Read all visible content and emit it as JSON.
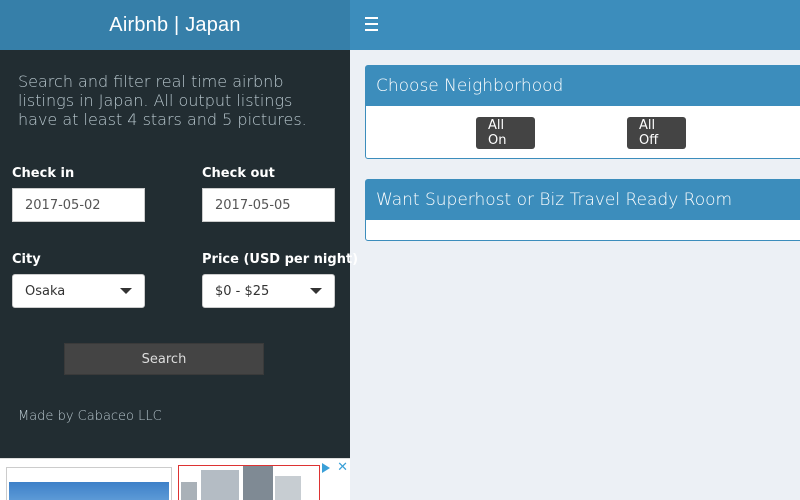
{
  "app": {
    "title": "Airbnb | Japan"
  },
  "sidebar": {
    "intro": "Search and filter real time airbnb listings in Japan. All output listings have at least 4 stars and 5 pictures.",
    "checkin": {
      "label": "Check in",
      "value": "2017-05-02"
    },
    "checkout": {
      "label": "Check out",
      "value": "2017-05-05"
    },
    "city": {
      "label": "City",
      "value": "Osaka"
    },
    "price": {
      "label": "Price (USD per night)",
      "value": "$0 - $25"
    },
    "search_label": "Search",
    "footer": "Made by Cabaceo LLC"
  },
  "ad": {
    "close": "✕"
  },
  "main": {
    "neighborhood": {
      "title": "Choose Neighborhood",
      "all_on": "All On",
      "all_off": "All Off"
    },
    "superhost": {
      "title": "Want Superhost or Biz Travel Ready Room"
    }
  },
  "colors": {
    "accent": "#3c8dbc",
    "brand": "#367fa9",
    "sidebar_bg": "#222d32",
    "content_bg": "#ecf0f5"
  }
}
